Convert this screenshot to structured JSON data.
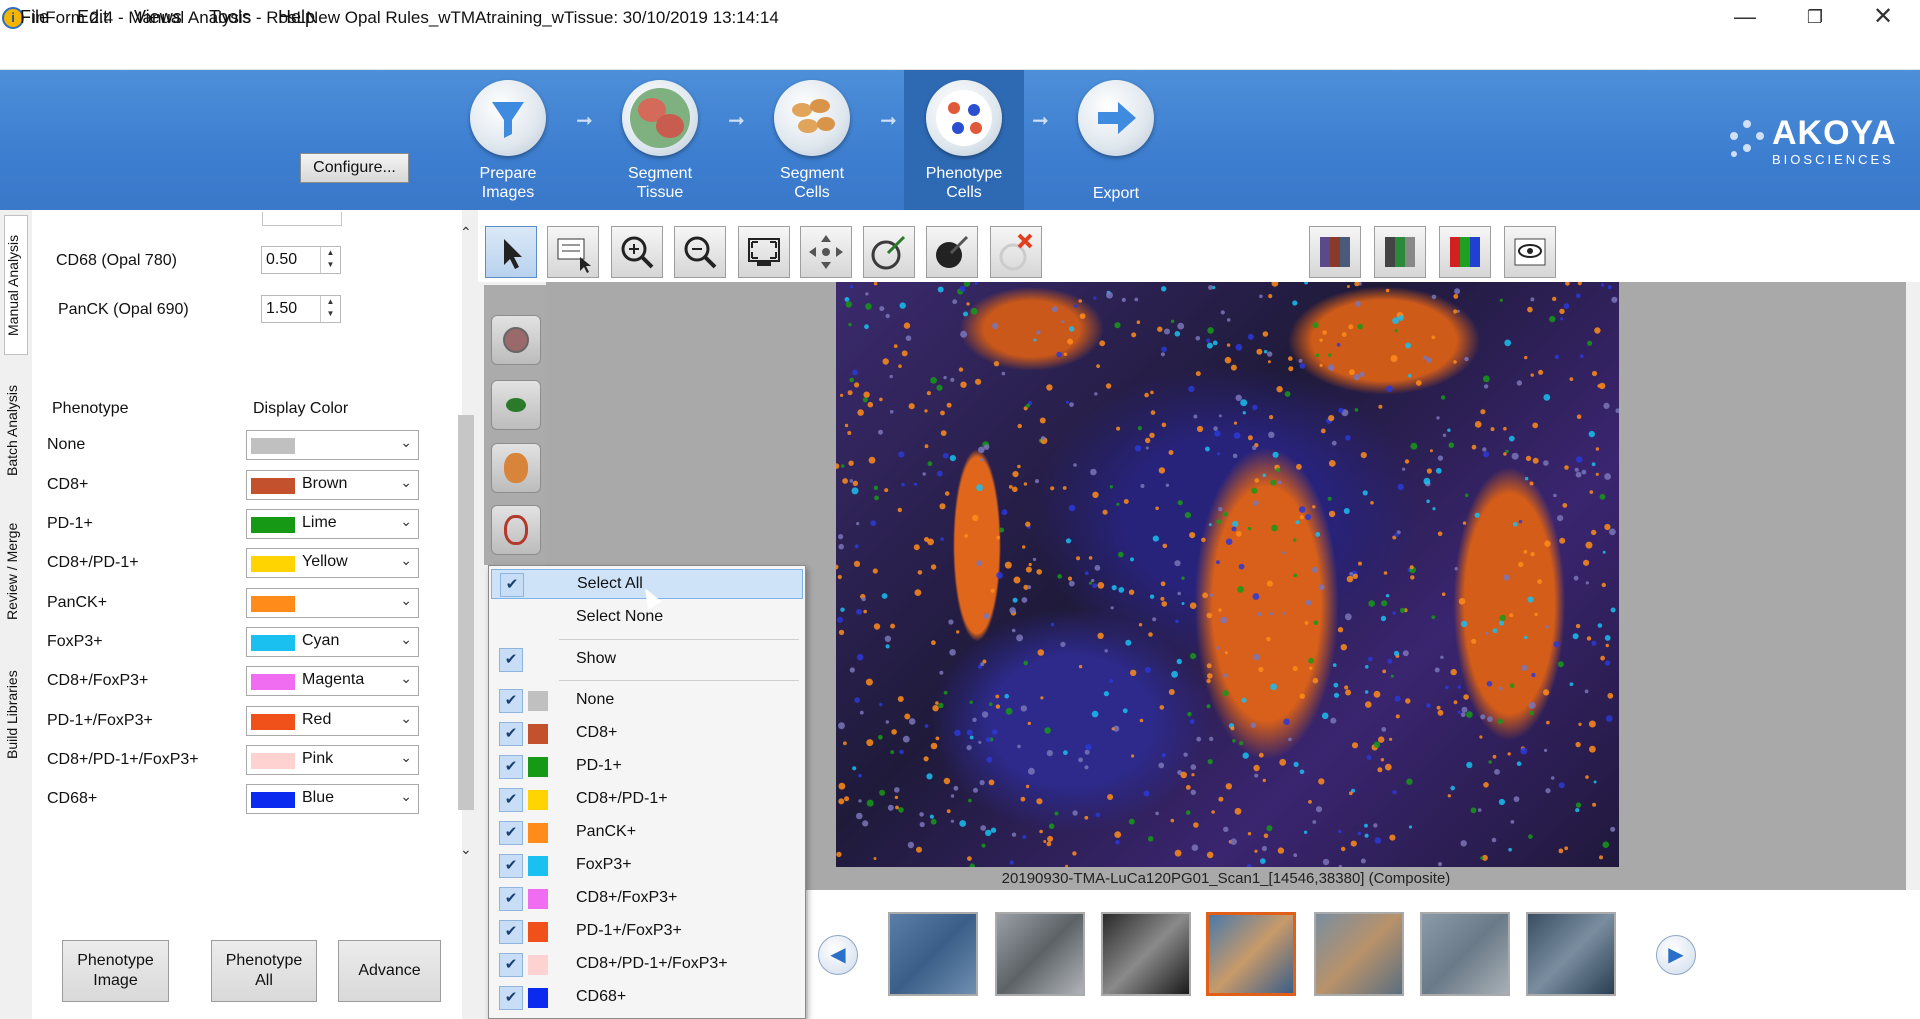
{
  "window": {
    "title": "inForm 2.4 - Manual  Analysis - RosLNew Opal Rules_wTMAtraining_wTissue: 30/10/2019 13:14:14",
    "minimize": "—",
    "restore": "❐",
    "close": "✕"
  },
  "menu": [
    "File",
    "Edit",
    "Views",
    "Tools",
    "Help"
  ],
  "banner": {
    "configure_label": "Configure...",
    "steps": [
      {
        "label": "Prepare\nImages"
      },
      {
        "label": "Segment\nTissue"
      },
      {
        "label": "Segment\nCells"
      },
      {
        "label": "Phenotype\nCells",
        "active": true
      },
      {
        "label": "Export"
      }
    ],
    "logo_name": "AKOYA",
    "logo_sub": "BIOSCIENCES"
  },
  "vertical_tabs": [
    "Manual Analysis",
    "Batch Analysis",
    "Review / Merge",
    "Build Libraries"
  ],
  "left_panel": {
    "params": [
      {
        "label": "CD68 (Opal 780)",
        "value": "0.50"
      },
      {
        "label": "PanCK (Opal 690)",
        "value": "1.50"
      }
    ],
    "phenotype_header": "Phenotype",
    "color_header": "Display Color",
    "phenotypes": [
      {
        "name": "None",
        "color_name": "",
        "color": "#c0c0c0"
      },
      {
        "name": "CD8+",
        "color_name": "Brown",
        "color": "#c4512d"
      },
      {
        "name": "PD-1+",
        "color_name": "Lime",
        "color": "#169a16"
      },
      {
        "name": "CD8+/PD-1+",
        "color_name": "Yellow",
        "color": "#ffd400"
      },
      {
        "name": "PanCK+",
        "color_name": "",
        "color": "#ff8c1a"
      },
      {
        "name": "FoxP3+",
        "color_name": "Cyan",
        "color": "#19c0f0"
      },
      {
        "name": "CD8+/FoxP3+",
        "color_name": "Magenta",
        "color": "#f06cf0"
      },
      {
        "name": "PD-1+/FoxP3+",
        "color_name": "Red",
        "color": "#f0501a"
      },
      {
        "name": "CD8+/PD-1+/FoxP3+",
        "color_name": "Pink",
        "color": "#ffd2d2"
      },
      {
        "name": "CD68+",
        "color_name": "Blue",
        "color": "#0a2af0"
      }
    ],
    "buttons": [
      "Phenotype\nImage",
      "Phenotype\nAll",
      "Advance"
    ]
  },
  "popup_menu": {
    "select_all": "Select All",
    "select_none": "Select None",
    "show": "Show",
    "items": [
      {
        "label": "None",
        "color": "#c0c0c0"
      },
      {
        "label": "CD8+",
        "color": "#c4512d"
      },
      {
        "label": "PD-1+",
        "color": "#169a16"
      },
      {
        "label": "CD8+/PD-1+",
        "color": "#ffd400"
      },
      {
        "label": "PanCK+",
        "color": "#ff8c1a"
      },
      {
        "label": "FoxP3+",
        "color": "#19c0f0"
      },
      {
        "label": "CD8+/FoxP3+",
        "color": "#f06cf0"
      },
      {
        "label": "PD-1+/FoxP3+",
        "color": "#f0501a"
      },
      {
        "label": "CD8+/PD-1+/FoxP3+",
        "color": "#ffd2d2"
      },
      {
        "label": "CD68+",
        "color": "#0a2af0"
      }
    ]
  },
  "viewer": {
    "caption": "20190930-TMA-LuCa120PG01_Scan1_[14546,38380]  (Composite)"
  },
  "colors": {
    "banner": "#4d8fd9",
    "active_step": "#2e6ab4",
    "selected_thumb_border": "#e0601a"
  }
}
